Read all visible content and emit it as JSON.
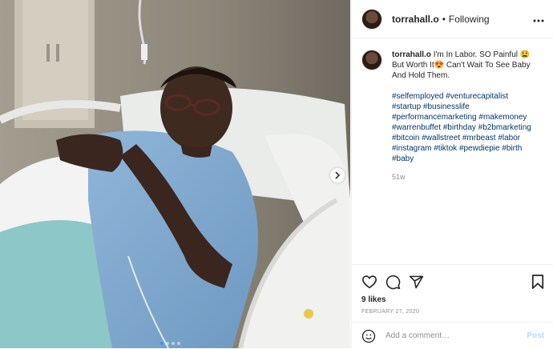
{
  "post": {
    "username": "torrahall.o",
    "follow_separator": "•",
    "follow_status": "Following",
    "more_icon": "more-horizontal-icon",
    "caption": "I'm In Labor. SO Painful 😫 But Worth It😍 Can't Wait To See Baby And Hold Them.",
    "hashtags": [
      "#selfemployed",
      "#venturecapitalist",
      "#startup",
      "#businesslife",
      "#performancemarketing",
      "#makemoney",
      "#warrenbuffet",
      "#birthday",
      "#b2bmarketing",
      "#bitcoin",
      "#wallstreet",
      "#mrbeast",
      "#labor",
      "#instagram",
      "#tiktok",
      "#pewdiepie",
      "#birth",
      "#baby"
    ],
    "time_ago": "51w",
    "likes": "9 likes",
    "date": "FEBRUARY 27, 2020"
  },
  "carousel": {
    "next_icon": "chevron-right-icon",
    "slide_count": 4,
    "active_slide": 1
  },
  "actions": {
    "like_icon": "heart-icon",
    "comment_icon": "comment-icon",
    "share_icon": "share-icon",
    "save_icon": "bookmark-icon"
  },
  "comment_box": {
    "emoji_icon": "smile-icon",
    "placeholder": "Add a comment…",
    "post_label": "Post"
  },
  "colors": {
    "link": "#00376b",
    "muted": "#8e8e8e",
    "post_disabled": "#b3dbff",
    "carousel_active": "#3897f0"
  }
}
